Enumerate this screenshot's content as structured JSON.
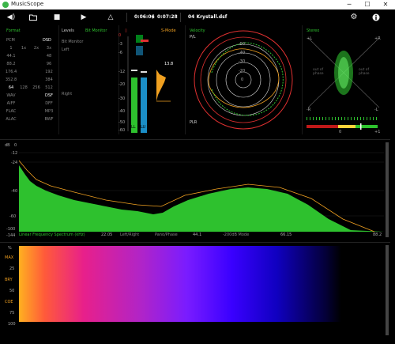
{
  "app": {
    "title": "MusicScope"
  },
  "window_controls": {
    "minimize": "─",
    "maximize": "☐",
    "close": "✕"
  },
  "toolbar": {
    "time_current": "0:06:06",
    "time_total": "0:07:28",
    "track": "04 Krystall.dsf"
  },
  "format": {
    "title": "Format",
    "pcm": "PCM",
    "dsd": "DSD",
    "rows": [
      [
        "1",
        "1x",
        "2x",
        "3x"
      ],
      [
        "44.1",
        "",
        "",
        "48"
      ],
      [
        "88.2",
        "",
        "",
        "96"
      ],
      [
        "176.4",
        "",
        "",
        "192"
      ],
      [
        "352.8",
        "",
        "",
        "384"
      ],
      [
        "64",
        "128",
        "256",
        "512"
      ],
      [
        "WAV",
        "",
        "",
        "DSF"
      ],
      [
        "AIFF",
        "",
        "",
        "DFF"
      ],
      [
        "FLAC",
        "",
        "",
        "MP3"
      ],
      [
        "ALAC",
        "",
        "",
        "BWF"
      ]
    ]
  },
  "levels": {
    "title": "Levels",
    "mode": "Bit Monitor",
    "bit_monitor": "Bit Monitor",
    "left": "Left",
    "right": "Right"
  },
  "meter": {
    "s_mode": "S-Mode",
    "peak": "13.8",
    "scale": [
      "0",
      "-3",
      "-6",
      "-12",
      "-20",
      "-30",
      "-40",
      "-50",
      "-60"
    ],
    "ch_l": "LL",
    "ch_r": "LU",
    "level_l": 0.62,
    "level_r": 0.6
  },
  "velocity": {
    "title": "Velocity",
    "pl": "P/L",
    "plr": "PLR",
    "rings": [
      "0",
      "-20",
      "-30",
      "-40",
      "-50"
    ]
  },
  "stereo": {
    "title": "Stereo",
    "plus_l": "+L",
    "plus_r": "+R",
    "minus_r": "-R",
    "minus_l": "-L",
    "out_of_phase_l": "out of phase",
    "out_of_phase_r": "out of phase",
    "zero": "0",
    "plus_one": "+1"
  },
  "spectrum": {
    "db_label": "dB",
    "y_ticks": [
      "0",
      "-12",
      "-24",
      "-40",
      "-60",
      "-100",
      "-144"
    ],
    "x_ticks": [
      "22.05",
      "44.1",
      "66.15",
      "88.2"
    ],
    "bottom_bar": {
      "mode": "Linear Frequency Spectrum (kHz)",
      "left_right": "Left/Right",
      "pano": "Pano/Phase",
      "db_mode": "-200dB Mode"
    }
  },
  "sonogram": {
    "y_ticks": [
      "%",
      "MAX",
      "25",
      "BRY",
      "50",
      "COE",
      "75",
      "100"
    ]
  },
  "colors": {
    "green": "#2ec12e",
    "red": "#e03030",
    "orange": "#f0a020",
    "blue": "#1b8ec6"
  }
}
